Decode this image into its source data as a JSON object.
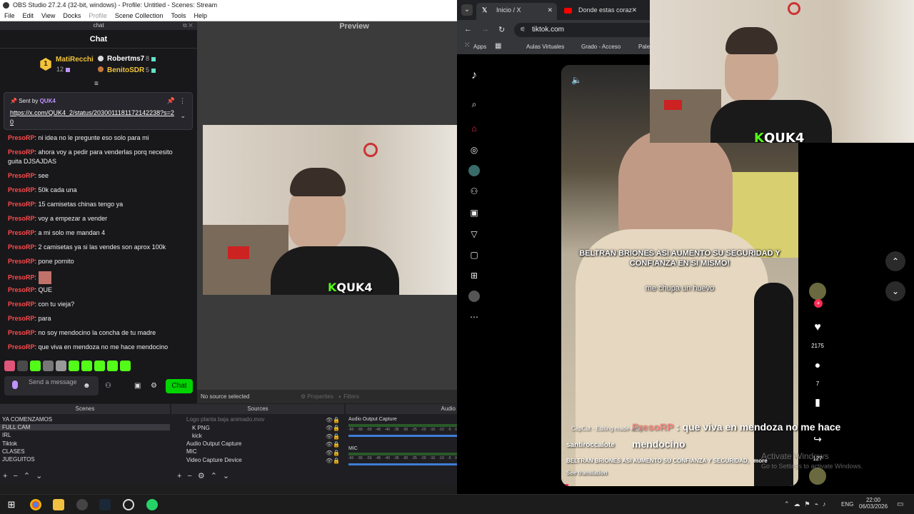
{
  "obs": {
    "title": "OBS Studio 27.2.4 (32-bit, windows) - Profile: Untitled - Scenes: Stream",
    "menu": [
      "File",
      "Edit",
      "View",
      "Docks",
      "Profile",
      "Scene Collection",
      "Tools",
      "Help"
    ],
    "chat_dock_title": "chat",
    "preview_label": "Preview",
    "chat": {
      "header": "Chat",
      "leaderboard": {
        "rank": "1",
        "first": {
          "name": "MatiRecchi",
          "count": "12"
        },
        "second": {
          "name": "Robertms7",
          "count": "8"
        },
        "third": {
          "name": "BenitoSDR",
          "count": "5"
        }
      },
      "pinned": {
        "sent_by": "Sent by",
        "user": "QUK4",
        "link": "https://x.com/QUK4_2/status/2030011181172142238?s=20"
      },
      "messages": [
        {
          "user": "PresoRP",
          "text": "ni idea no le pregunte eso solo para mi"
        },
        {
          "user": "PresoRP",
          "text": "ahora voy a pedir para venderlas porq necesito guita DJSAJDAS"
        },
        {
          "user": "PresoRP",
          "text": "see"
        },
        {
          "user": "PresoRP",
          "text": "50k cada una"
        },
        {
          "user": "PresoRP",
          "text": "15 camisetas chinas tengo ya"
        },
        {
          "user": "PresoRP",
          "text": "voy a empezar a vender"
        },
        {
          "user": "PresoRP",
          "text": "a mi solo me mandan 4"
        },
        {
          "user": "PresoRP",
          "text": "2 camisetas ya si las vendes son aprox 100k"
        },
        {
          "user": "PresoRP",
          "text": "pone pornito"
        },
        {
          "user": "PresoRP",
          "text": ""
        },
        {
          "user": "PresoRP",
          "text": "QUE"
        },
        {
          "user": "PresoRP",
          "text": "con tu vieja?"
        },
        {
          "user": "PresoRP",
          "text": "para"
        },
        {
          "user": "PresoRP",
          "text": "no soy mendocino la concha de tu madre"
        },
        {
          "user": "PresoRP",
          "text": "que viva en mendoza no me hace mendocino"
        }
      ],
      "input_placeholder": "Send a message",
      "send_label": "Chat"
    },
    "status": {
      "no_source": "No source selected",
      "properties": "Properties",
      "filters": "Filters"
    },
    "scenes_title": "Scenes",
    "sources_title": "Sources",
    "audio_title": "Audio",
    "scenes": [
      "YA COMENZAMOS",
      "FULL CAM",
      "IRL",
      "Tiktok",
      "CLASES",
      "JUEGUITOS"
    ],
    "sources": [
      "Logo planta baja animado.mov",
      "K PNG",
      "kick",
      "Audio Output Capture",
      "MIC",
      "Video Capture Device"
    ],
    "audio": [
      {
        "name": "Audio Output Capture"
      },
      {
        "name": "MIC"
      }
    ],
    "meter_ticks": [
      "-60",
      "-55",
      "-50",
      "-45",
      "-40",
      "-35",
      "-30",
      "-25",
      "-20",
      "-15",
      "-10",
      "-5",
      "0"
    ]
  },
  "overlay": {
    "brand": "QUK4"
  },
  "browser": {
    "tabs": [
      {
        "label": "Inicio / X"
      },
      {
        "label": "Donde estas coraz"
      }
    ],
    "url": "tiktok.com",
    "bookmarks": [
      "Apps",
      "Aulas Virtuales",
      "Grado - Acceso",
      "Pale"
    ]
  },
  "tiktok": {
    "caption_overlay": "BELTRAN BRIONES ASI AUMENTO SU SEGURIDAD Y CONFIANZA EN SI MISMO!",
    "subtitle": "me chupa un huevo",
    "capcut": "CapCut · Editing made easy",
    "author": "santiroccalote",
    "description": "BELTRAN BRIONES ASI AUMENTO SU CONFIANZA Y SEGURIDAD,",
    "more": "more",
    "translation": "See translation",
    "likes": "2175",
    "comments": "7",
    "shares": "127",
    "chat_overlay": {
      "user": "PresoRP",
      "text": "que viva en mendoza no me hace mendocino"
    },
    "activate": [
      "Activate Windows",
      "Go to Settings to activate Windows."
    ]
  },
  "taskbar": {
    "lang": "ENG",
    "time": "22:00",
    "date": "06/03/2026"
  }
}
